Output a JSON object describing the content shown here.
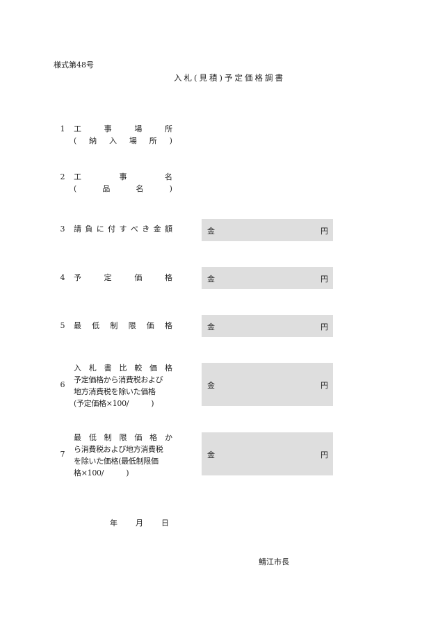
{
  "form_number": "様式第48号",
  "title": "入札(見積)予定価格調書",
  "items": [
    {
      "num": "1",
      "label_lines": [
        "工事場所",
        "(納入場所)"
      ]
    },
    {
      "num": "2",
      "label_lines": [
        "工事名",
        "(品名)"
      ]
    },
    {
      "num": "3",
      "label_lines": [
        "請負に付すべき金額"
      ],
      "amount_prefix": "金",
      "amount_suffix": "円"
    },
    {
      "num": "4",
      "label_lines": [
        "予定価格"
      ],
      "amount_prefix": "金",
      "amount_suffix": "円"
    },
    {
      "num": "5",
      "label_lines": [
        "最低制限価格"
      ],
      "amount_prefix": "金",
      "amount_suffix": "円"
    },
    {
      "num": "6",
      "label_lines": [
        "入札書比較価格",
        "予定価格から消費税および",
        "地方消費税を除いた価格",
        "(予定価格×100/　　　)"
      ],
      "amount_prefix": "金",
      "amount_suffix": "円"
    },
    {
      "num": "7",
      "label_lines": [
        "最低制限価格か",
        "ら消費税および地方消費税",
        "を除いた価格(最低制限価",
        "格×100/　　　)"
      ],
      "amount_prefix": "金",
      "amount_suffix": "円"
    }
  ],
  "date_labels": [
    "年",
    "月",
    "日"
  ],
  "signer": "鯖江市長"
}
